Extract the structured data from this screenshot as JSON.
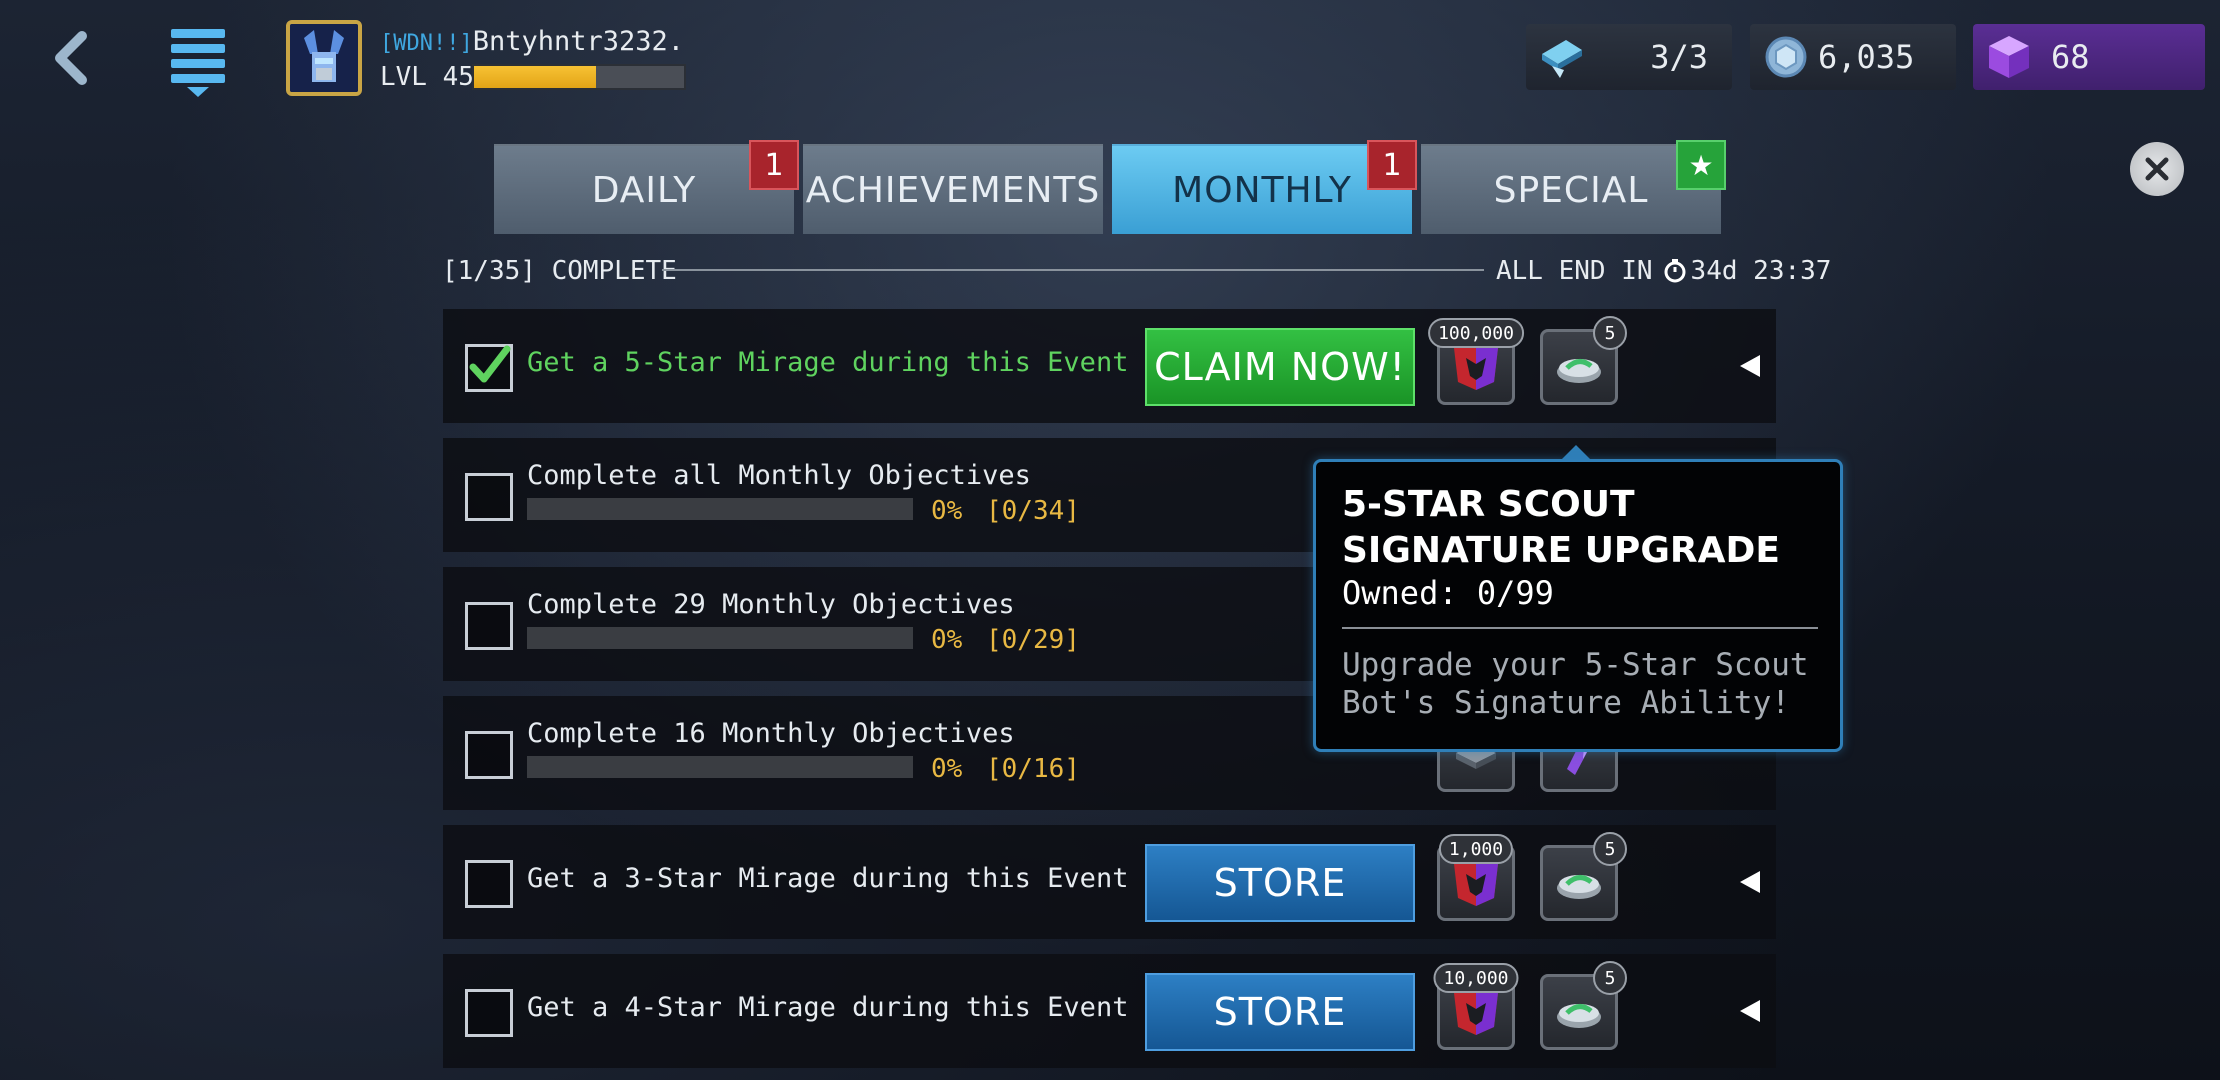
{
  "player": {
    "tag": "[WDN!!]",
    "name": "Bntyhntr3232.",
    "level_label": "LVL 45",
    "xp_fraction": 0.58
  },
  "currencies": {
    "energy": "3/3",
    "coins": "6,035",
    "gems": "68"
  },
  "tabs": [
    {
      "label": "DAILY",
      "badge": "1"
    },
    {
      "label": "ACHIEVEMENTS",
      "badge": ""
    },
    {
      "label": "MONTHLY",
      "badge": "1",
      "active": true
    },
    {
      "label": "SPECIAL",
      "badge": "★"
    }
  ],
  "summary": {
    "complete": "[1/35] COMPLETE",
    "end_label": "ALL END IN",
    "end_time": "34d 23:37"
  },
  "objectives": [
    {
      "text": "Get a 5-Star Mirage during this Event",
      "checked": true,
      "button": "CLAIM NOW!",
      "reward1_count": "100,000",
      "reward2_count": "5"
    },
    {
      "text": "Complete all Monthly Objectives",
      "percent": "0%",
      "count": "[0/34]"
    },
    {
      "text": "Complete 29 Monthly Objectives",
      "percent": "0%",
      "count": "[0/29]"
    },
    {
      "text": "Complete 16 Monthly Objectives",
      "percent": "0%",
      "count": "[0/16]"
    },
    {
      "text": "Get a 3-Star Mirage during this Event",
      "checked": false,
      "button": "STORE",
      "reward1_count": "1,000",
      "reward2_count": "5"
    },
    {
      "text": "Get a 4-Star Mirage during this Event",
      "checked": false,
      "button": "STORE",
      "reward1_count": "10,000",
      "reward2_count": "5"
    }
  ],
  "tooltip": {
    "title": "5-STAR SCOUT SIGNATURE UPGRADE",
    "owned": "Owned: 0/99",
    "description": "Upgrade your 5-Star Scout Bot's Signature Ability!"
  },
  "colors": {
    "accent_blue": "#3a9fd4",
    "claim_green": "#1a9426",
    "store_blue": "#155794",
    "progress_gold": "#e8b843",
    "badge_red": "#a8242c"
  }
}
